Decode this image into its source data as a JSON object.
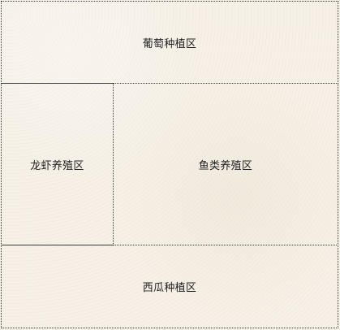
{
  "regions": {
    "grape": {
      "label": "葡萄种植区"
    },
    "crayfish": {
      "label": "龙虾养殖区"
    },
    "fish": {
      "label": "鱼类养殖区"
    },
    "watermelon": {
      "label": "西瓜种植区"
    }
  },
  "colors": {
    "background": "#f6f0e6",
    "border": "#3a3a3a",
    "text": "#222222"
  }
}
